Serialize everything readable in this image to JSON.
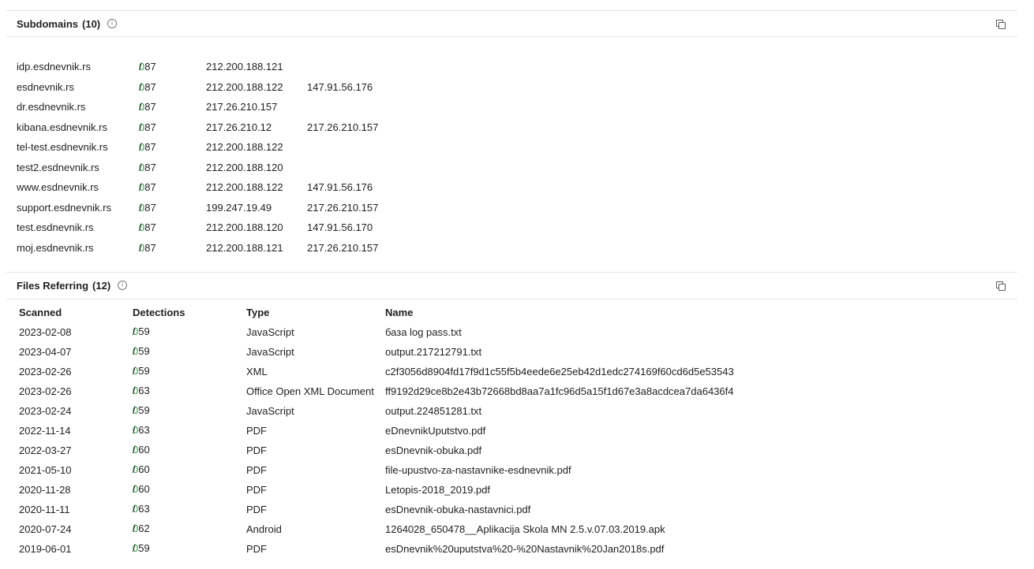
{
  "subdomains": {
    "title": "Subdomains",
    "count": "(10)",
    "rows": [
      {
        "domain": "idp.esdnevnik.rs",
        "pos": "0",
        "total": "/ 87",
        "ip1": "212.200.188.121",
        "ip2": ""
      },
      {
        "domain": "esdnevnik.rs",
        "pos": "0",
        "total": "/ 87",
        "ip1": "212.200.188.122",
        "ip2": "147.91.56.176"
      },
      {
        "domain": "dr.esdnevnik.rs",
        "pos": "0",
        "total": "/ 87",
        "ip1": "217.26.210.157",
        "ip2": ""
      },
      {
        "domain": "kibana.esdnevnik.rs",
        "pos": "0",
        "total": "/ 87",
        "ip1": "217.26.210.12",
        "ip2": "217.26.210.157"
      },
      {
        "domain": "tel-test.esdnevnik.rs",
        "pos": "0",
        "total": "/ 87",
        "ip1": "212.200.188.122",
        "ip2": ""
      },
      {
        "domain": "test2.esdnevnik.rs",
        "pos": "0",
        "total": "/ 87",
        "ip1": "212.200.188.120",
        "ip2": ""
      },
      {
        "domain": "www.esdnevnik.rs",
        "pos": "0",
        "total": "/ 87",
        "ip1": "212.200.188.122",
        "ip2": "147.91.56.176"
      },
      {
        "domain": "support.esdnevnik.rs",
        "pos": "0",
        "total": "/ 87",
        "ip1": "199.247.19.49",
        "ip2": "217.26.210.157"
      },
      {
        "domain": "test.esdnevnik.rs",
        "pos": "0",
        "total": "/ 87",
        "ip1": "212.200.188.120",
        "ip2": "147.91.56.170"
      },
      {
        "domain": "moj.esdnevnik.rs",
        "pos": "0",
        "total": "/ 87",
        "ip1": "212.200.188.121",
        "ip2": "217.26.210.157"
      }
    ]
  },
  "files": {
    "title": "Files Referring",
    "count": "(12)",
    "columns": {
      "scanned": "Scanned",
      "detections": "Detections",
      "type": "Type",
      "name": "Name"
    },
    "rows": [
      {
        "scanned": "2023-02-08",
        "pos": "0",
        "total": "/ 59",
        "type": "JavaScript",
        "name": "база log pass.txt"
      },
      {
        "scanned": "2023-04-07",
        "pos": "0",
        "total": "/ 59",
        "type": "JavaScript",
        "name": "output.217212791.txt"
      },
      {
        "scanned": "2023-02-26",
        "pos": "0",
        "total": "/ 59",
        "type": "XML",
        "name": "c2f3056d8904fd17f9d1c55f5b4eede6e25eb42d1edc274169f60cd6d5e53543"
      },
      {
        "scanned": "2023-02-26",
        "pos": "0",
        "total": "/ 63",
        "type": "Office Open XML Document",
        "name": "ff9192d29ce8b2e43b72668bd8aa7a1fc96d5a15f1d67e3a8acdcea7da6436f4"
      },
      {
        "scanned": "2023-02-24",
        "pos": "0",
        "total": "/ 59",
        "type": "JavaScript",
        "name": "output.224851281.txt"
      },
      {
        "scanned": "2022-11-14",
        "pos": "0",
        "total": "/ 63",
        "type": "PDF",
        "name": "eDnevnikUputstvo.pdf"
      },
      {
        "scanned": "2022-03-27",
        "pos": "0",
        "total": "/ 60",
        "type": "PDF",
        "name": "esDnevnik-obuka.pdf"
      },
      {
        "scanned": "2021-05-10",
        "pos": "0",
        "total": "/ 60",
        "type": "PDF",
        "name": "file-upustvo-za-nastavnike-esdnevnik.pdf"
      },
      {
        "scanned": "2020-11-28",
        "pos": "0",
        "total": "/ 60",
        "type": "PDF",
        "name": "Letopis-2018_2019.pdf"
      },
      {
        "scanned": "2020-11-11",
        "pos": "0",
        "total": "/ 63",
        "type": "PDF",
        "name": "esDnevnik-obuka-nastavnici.pdf"
      },
      {
        "scanned": "2020-07-24",
        "pos": "0",
        "total": "/ 62",
        "type": "Android",
        "name": "1264028_650478__Aplikacija Skola MN 2.5.v.07.03.2019.apk"
      },
      {
        "scanned": "2019-06-01",
        "pos": "0",
        "total": "/ 59",
        "type": "PDF",
        "name": "esDnevnik%20uputstva%20-%20Nastavnik%20Jan2018s.pdf"
      }
    ]
  },
  "icons": {
    "info": "info-icon",
    "copy": "copy-icon"
  },
  "colors": {
    "detection_clean": "#2e9e3e",
    "divider": "#e6e6e6"
  }
}
